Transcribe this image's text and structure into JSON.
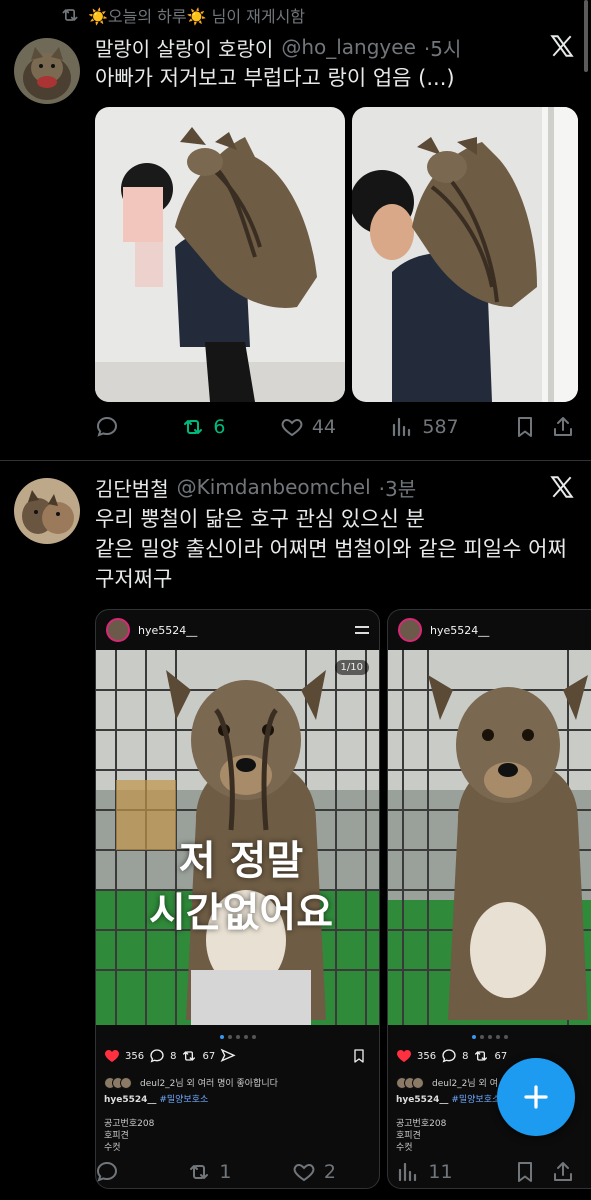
{
  "retweet_banner": {
    "text": "☀️오늘의 하루☀️ 님이 재게시함"
  },
  "tweets": [
    {
      "name": "말랑이 살랑이 호랑이",
      "handle": "@ho_langyee",
      "time": "·5시",
      "text": "아빠가 저거보고 부럽다고 랑이 업음 (...)",
      "actions": {
        "reply": "",
        "retweet": "6",
        "like": "44",
        "views": "587"
      }
    },
    {
      "name": "김단범철",
      "handle": "@Kimdanbeomchel",
      "time": "·3분",
      "text_lines": [
        "우리 뿡철이 닮은 호구 관심 있으신 분",
        "같은 밀양 출신이라 어쩌면 범철이와 같은 피일수 어쩌",
        "구저쩌구"
      ],
      "embed": {
        "username": "hye5524__",
        "counter": "1/10",
        "overlay_line1": "저 정말",
        "overlay_line2": "시간없어요",
        "likes": "356",
        "comments": "8",
        "reposts": "67",
        "liked_by": "deul2_2님 외 여러 명이 좋아합니다",
        "liked_by_short": "deul2_2님 외 여",
        "caption_user": "hye5524__",
        "caption_tag": "#밀양보호소",
        "notes": [
          "공고번호208",
          "호피견",
          "수컷"
        ]
      },
      "actions": {
        "reply": "",
        "retweet": "1",
        "like": "2",
        "views": "11"
      }
    }
  ],
  "colors": {
    "background": "#000000",
    "accent": "#1d9bf0",
    "retweet_active": "#00ba7c",
    "muted": "#71767b",
    "like_red": "#ff3040"
  },
  "icons": [
    "retweet-icon",
    "x-logo-icon",
    "reply-icon",
    "like-icon",
    "views-icon",
    "bookmark-icon",
    "share-icon",
    "compose-plus-icon"
  ]
}
